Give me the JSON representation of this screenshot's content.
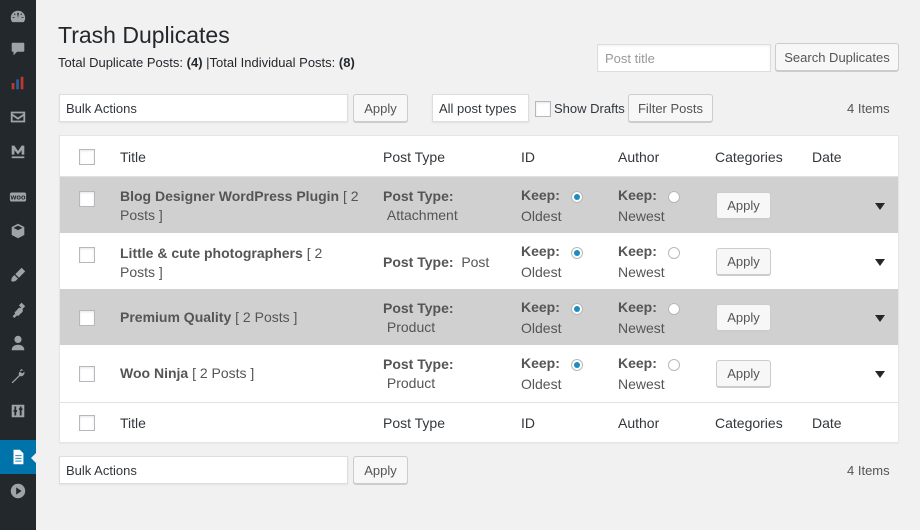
{
  "sidebar": {
    "items": [
      {
        "icon": "dashboard-icon"
      },
      {
        "icon": "comments-icon"
      },
      {
        "icon": "chart-icon"
      },
      {
        "icon": "mail-icon"
      },
      {
        "icon": "m-logo-icon"
      },
      {
        "icon": "woo-icon"
      },
      {
        "icon": "box-icon"
      },
      {
        "icon": "brush-icon"
      },
      {
        "icon": "plugin-icon"
      },
      {
        "icon": "user-icon"
      },
      {
        "icon": "wrench-icon"
      },
      {
        "icon": "settings-icon"
      },
      {
        "icon": "page-icon",
        "active": true
      },
      {
        "icon": "play-icon"
      }
    ],
    "active_color": "#0073aa"
  },
  "header": {
    "title": "Trash Duplicates",
    "dup_label": "Total Duplicate Posts:",
    "dup_count": "(4)",
    "separator": "|",
    "ind_label": "Total Individual Posts:",
    "ind_count": "(8)"
  },
  "search": {
    "placeholder": "Post title",
    "button": "Search Duplicates"
  },
  "toolbar_top": {
    "bulk_select": "Bulk Actions",
    "apply": "Apply",
    "post_types": "All post types",
    "show_drafts": "Show Drafts",
    "filter": "Filter Posts",
    "items": "4 Items"
  },
  "toolbar_bottom": {
    "bulk_select": "Bulk Actions",
    "apply": "Apply",
    "items": "4 Items"
  },
  "columns": [
    "Title",
    "Post Type",
    "ID",
    "Author",
    "Categories",
    "Date"
  ],
  "rows": [
    {
      "title": "Blog Designer WordPress Plugin",
      "count": "[ 2",
      "count2": "Posts ]",
      "type_label": "Post Type:",
      "type": "Attachment",
      "keep1": "Keep:",
      "oldest": "Oldest",
      "keep2": "Keep:",
      "newest": "Newest",
      "apply": "Apply"
    },
    {
      "title": "Little & cute photographers",
      "count": "[ 2",
      "count2": "Posts ]",
      "type_label": "Post Type:",
      "type": "Post",
      "keep1": "Keep:",
      "oldest": "Oldest",
      "keep2": "Keep:",
      "newest": "Newest",
      "apply": "Apply"
    },
    {
      "title": "Premium Quality",
      "count": "[ 2 Posts ]",
      "type_label": "Post Type:",
      "type": "Product",
      "keep1": "Keep:",
      "oldest": "Oldest",
      "keep2": "Keep:",
      "newest": "Newest",
      "apply": "Apply"
    },
    {
      "title": "Woo Ninja",
      "count": "[ 2 Posts ]",
      "type_label": "Post Type:",
      "type": "Product",
      "keep1": "Keep:",
      "oldest": "Oldest",
      "keep2": "Keep:",
      "newest": "Newest",
      "apply": "Apply"
    }
  ],
  "colors": {
    "grey_row": "#d0d0d0",
    "radio_selected": "#1e8cbe"
  }
}
